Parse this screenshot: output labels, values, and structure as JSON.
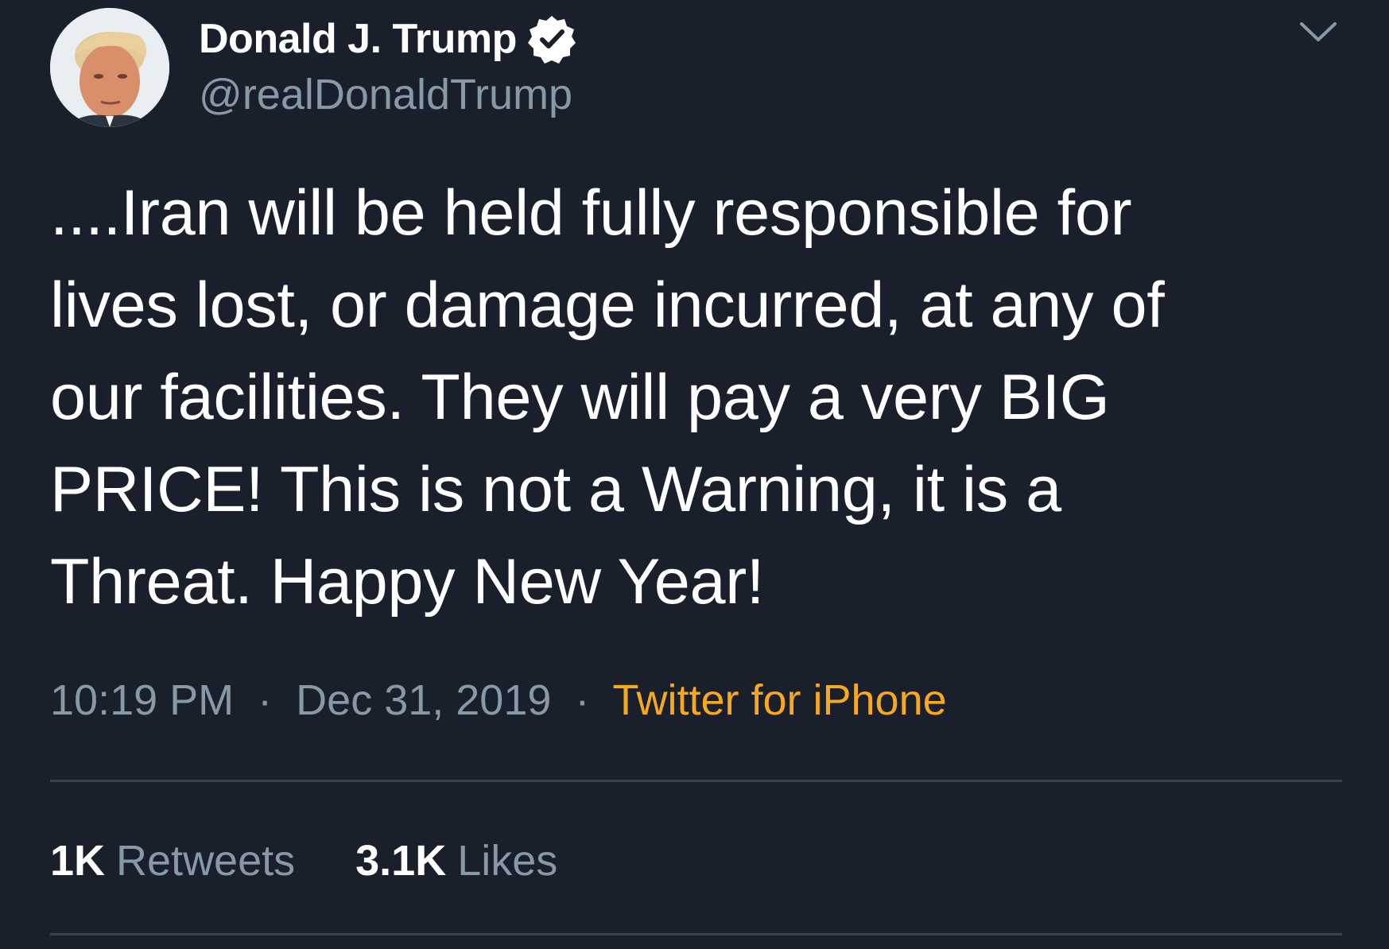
{
  "tweet": {
    "author": {
      "display_name": "Donald J. Trump",
      "handle": "@realDonaldTrump",
      "verified": true
    },
    "text": "....Iran will be held fully responsible for\nlives lost, or damage incurred, at any of\nour facilities. They will pay a very BIG\nPRICE! This is not a Warning, it is a\nThreat. Happy New Year!",
    "time": "10:19 PM",
    "separator": "·",
    "date": "Dec 31, 2019",
    "source": "Twitter for iPhone",
    "stats": {
      "retweets_count": "1K",
      "retweets_label": "Retweets",
      "likes_count": "3.1K",
      "likes_label": "Likes"
    }
  },
  "icons": {
    "verified": "verified-badge-icon",
    "menu": "chevron-down-icon"
  },
  "colors": {
    "background": "#1a202b",
    "primary_text": "#ffffff",
    "secondary_text": "#8899a6",
    "source_link": "#f6a821",
    "divider": "#38444d"
  }
}
